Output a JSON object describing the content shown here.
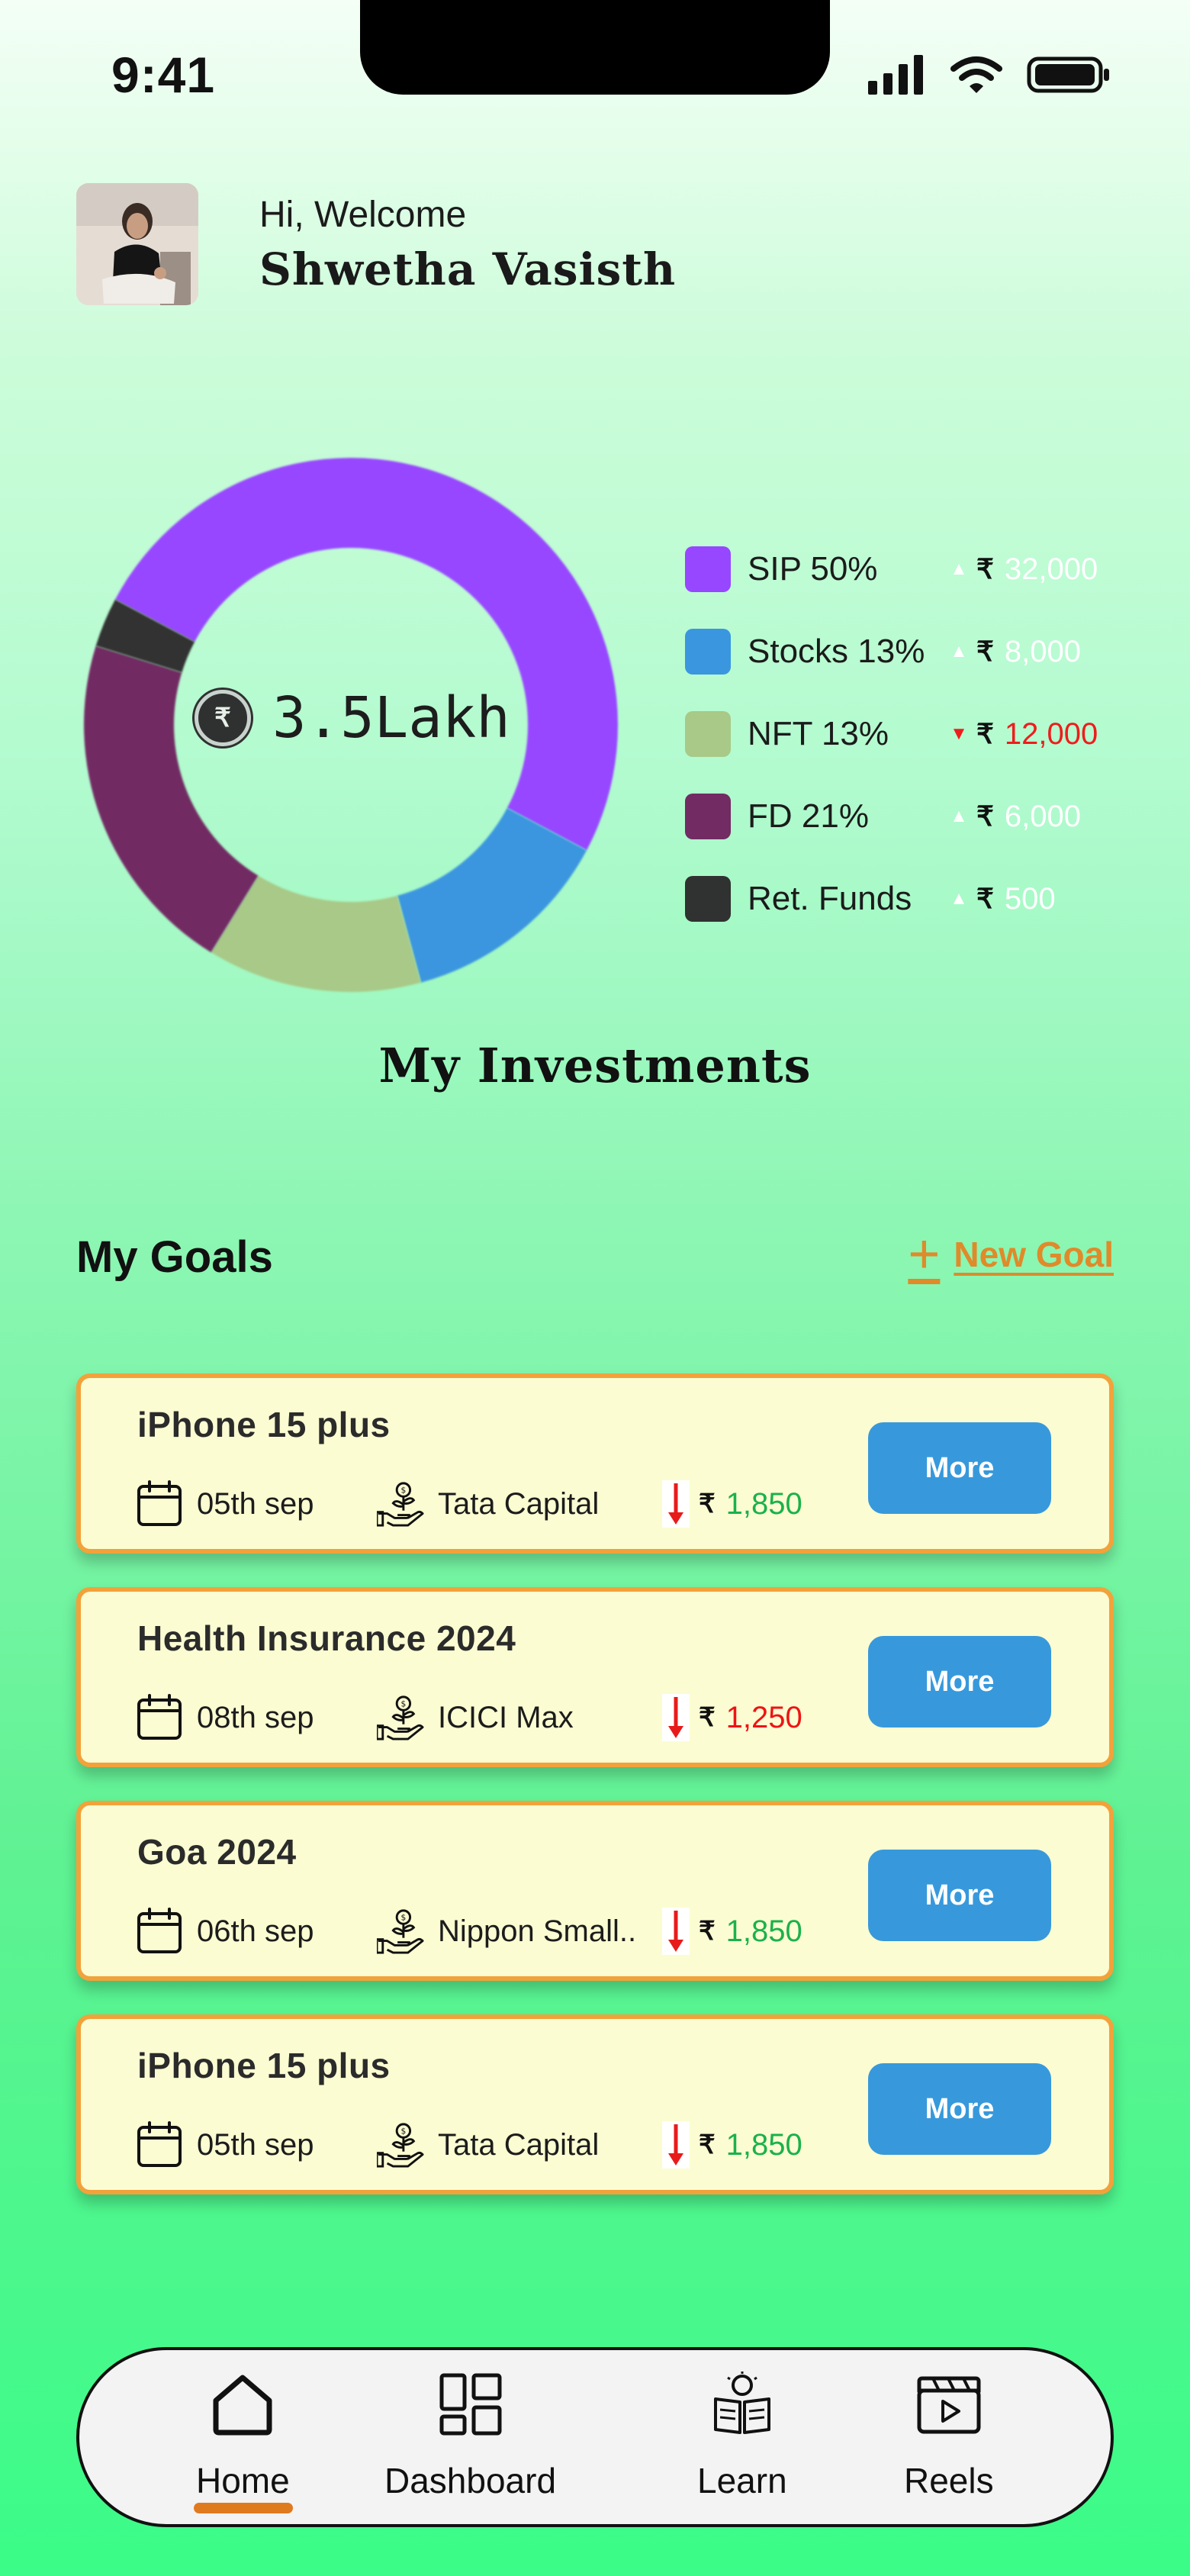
{
  "status_bar": {
    "time": "9:41",
    "icons": [
      "cellular-signal-icon",
      "wifi-icon",
      "battery-icon"
    ]
  },
  "profile": {
    "greeting": "Hi, Welcome",
    "name": "Shwetha Vasisth"
  },
  "portfolio": {
    "total": "3.5Lakh",
    "currency_icon": "rupee-coin-icon",
    "title": "My Investments",
    "legend": [
      {
        "label": "SIP 50%",
        "color": "#9747ff",
        "trend": "up",
        "currency": "₹",
        "amount": "32,000"
      },
      {
        "label": "Stocks 13%",
        "color": "#3a96df",
        "trend": "up",
        "currency": "₹",
        "amount": "8,000"
      },
      {
        "label": "NFT 13%",
        "color": "#a8c987",
        "trend": "down",
        "currency": "₹",
        "amount": "12,000"
      },
      {
        "label": "FD 21%",
        "color": "#722b63",
        "trend": "up",
        "currency": "₹",
        "amount": "6,000"
      },
      {
        "label": "Ret. Funds",
        "color": "#303131",
        "trend": "up",
        "currency": "₹",
        "amount": "500"
      }
    ],
    "trend_up_color": "#ffffff",
    "trend_down_color": "#ef1c1c"
  },
  "goals": {
    "title": "My Goals",
    "new_goal_label": "New Goal",
    "items": [
      {
        "name": "iPhone 15 plus",
        "date": "05th sep",
        "fund": "Tata Capital",
        "currency": "₹",
        "amount": "1,850",
        "amount_status": "green",
        "button": "More"
      },
      {
        "name": "Health Insurance 2024",
        "date": "08th sep",
        "fund": "ICICI Max",
        "currency": "₹",
        "amount": "1,250",
        "amount_status": "red",
        "button": "More"
      },
      {
        "name": "Goa 2024",
        "date": "06th sep",
        "fund": "Nippon Small..",
        "currency": "₹",
        "amount": "1,850",
        "amount_status": "green",
        "button": "More"
      },
      {
        "name": "iPhone 15 plus",
        "date": "05th sep",
        "fund": "Tata Capital",
        "currency": "₹",
        "amount": "1,850",
        "amount_status": "green",
        "button": "More"
      }
    ]
  },
  "bottom_nav": {
    "items": [
      {
        "label": "Home",
        "icon": "home-icon",
        "active": true
      },
      {
        "label": "Dashboard",
        "icon": "dashboard-icon",
        "active": false
      },
      {
        "label": "Learn",
        "icon": "learn-icon",
        "active": false
      },
      {
        "label": "Reels",
        "icon": "reels-icon",
        "active": false
      }
    ],
    "active_color": "#e07a1f"
  },
  "chart_data": {
    "type": "pie",
    "categories": [
      "SIP",
      "Stocks",
      "NFT",
      "FD",
      "Ret. Funds"
    ],
    "values": [
      50,
      13,
      13,
      21,
      3
    ],
    "colors": [
      "#9747ff",
      "#3a96df",
      "#a8c987",
      "#722b63",
      "#303131"
    ],
    "donut": true,
    "center_label": "3.5Lakh"
  }
}
